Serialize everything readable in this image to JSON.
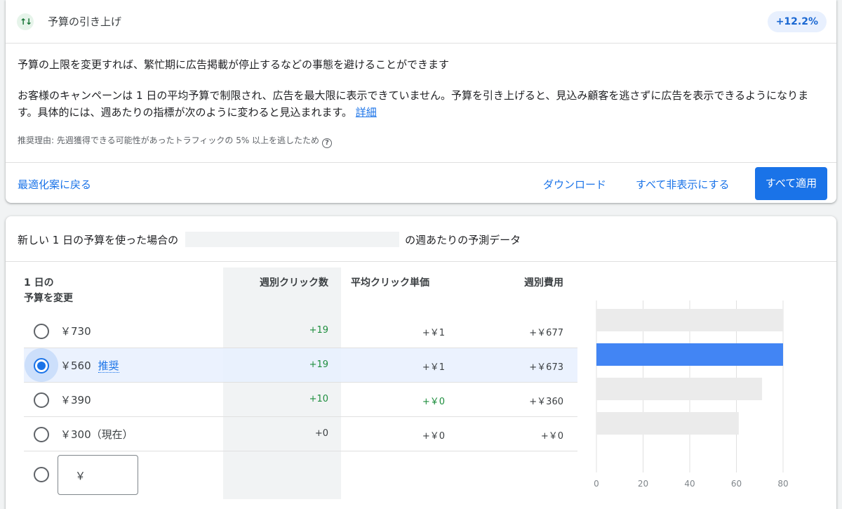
{
  "recommendation": {
    "icon": "trending-arrows-icon",
    "title": "予算の引き上げ",
    "badge": "+12.2%",
    "headline": "予算の上限を変更すれば、繁忙期に広告掲載が停止するなどの事態を避けることができます",
    "body": "お客様のキャンペーンは 1 日の平均予算で制限され、広告を最大限に表示できていません。予算を引き上げると、見込み顧客を逃さずに広告を表示できるようになります。具体的には、週あたりの指標が次のように変わると見込まれます。",
    "details_link": "詳細",
    "reason": "推奨理由: 先週獲得できる可能性があったトラフィックの 5% 以上を逃したため",
    "back_link": "最適化案に戻る",
    "download": "ダウンロード",
    "hide_all": "すべて非表示にする",
    "apply_all": "すべて適用"
  },
  "forecast": {
    "title_prefix": "新しい 1 日の予算を使った場合の",
    "title_suffix": "の週あたりの予測データ",
    "headers": {
      "budget_line1": "1 日の",
      "budget_line2": "予算を変更",
      "clicks": "週別クリック数",
      "cpc": "平均クリック単価",
      "cost": "週別費用"
    },
    "rows": [
      {
        "budget": "￥730",
        "recommended": "",
        "clicks": "+19",
        "cpc": "+￥1",
        "cost": "+￥677",
        "selected": false
      },
      {
        "budget": "￥560",
        "recommended": "推奨",
        "clicks": "+19",
        "cpc": "+￥1",
        "cost": "+￥673",
        "selected": true
      },
      {
        "budget": "￥390",
        "recommended": "",
        "clicks": "+10",
        "cpc": "+￥0",
        "cost": "+￥360",
        "selected": false
      },
      {
        "budget": "￥300（現在）",
        "recommended": "",
        "clicks": "+0",
        "cpc": "+￥0",
        "cost": "+￥0",
        "selected": false
      }
    ],
    "custom_input_prefix": "￥"
  },
  "chart_data": {
    "type": "bar",
    "orientation": "horizontal",
    "categories": [
      "￥730",
      "￥560",
      "￥390",
      "￥300（現在）"
    ],
    "values": [
      80,
      80,
      71,
      61
    ],
    "highlight_index": 1,
    "xlim": [
      0,
      80
    ],
    "xticks": [
      0,
      20,
      40,
      60,
      80
    ],
    "grid": true,
    "colors": {
      "bar": "#ebebeb",
      "highlight": "#4285f4",
      "grid": "#e0e0e0"
    }
  }
}
